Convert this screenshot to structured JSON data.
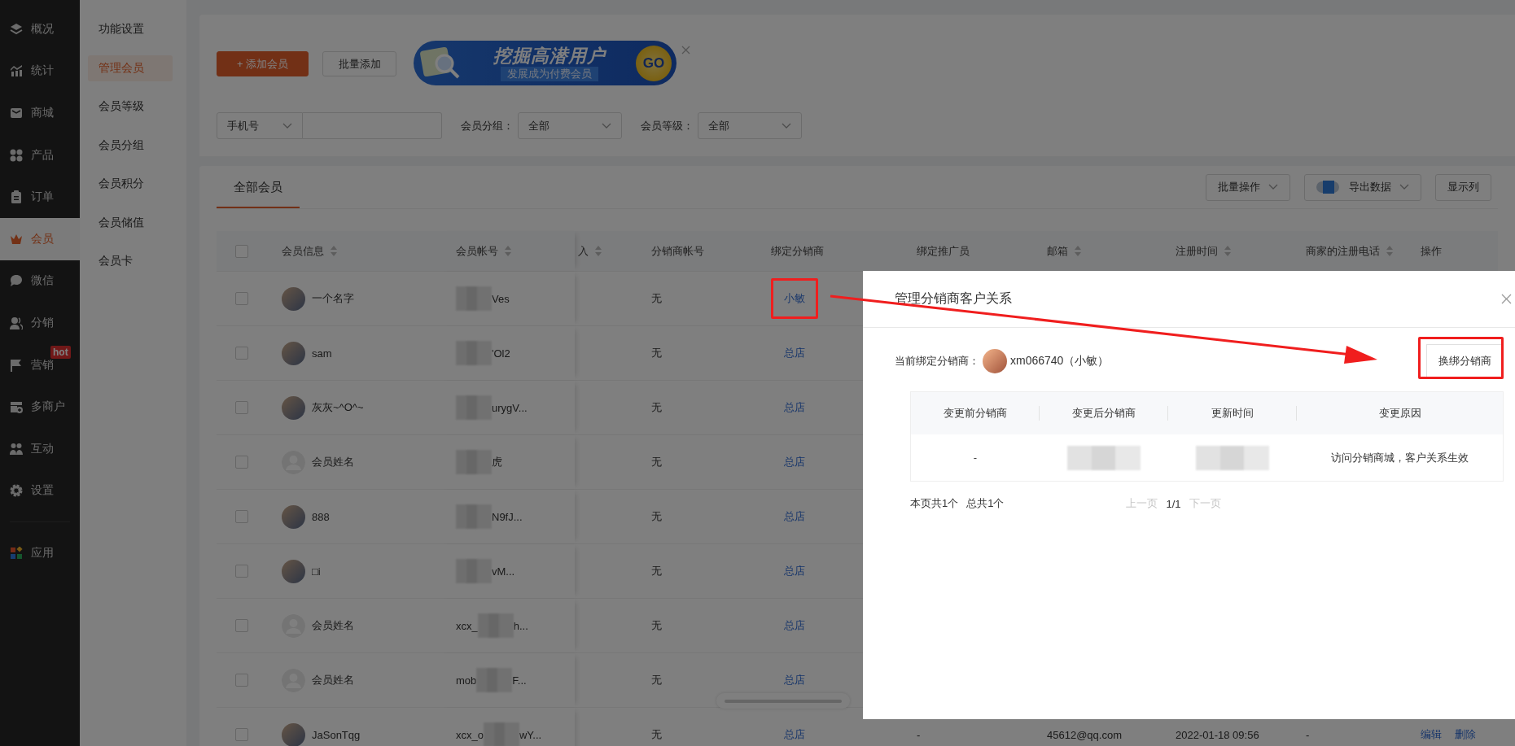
{
  "sidebar": {
    "items": [
      {
        "label": "概况",
        "selected": false
      },
      {
        "label": "统计",
        "selected": false
      },
      {
        "label": "商城",
        "selected": false
      },
      {
        "label": "产品",
        "selected": false
      },
      {
        "label": "订单",
        "selected": false
      },
      {
        "label": "会员",
        "selected": true
      },
      {
        "label": "微信",
        "selected": false
      },
      {
        "label": "分销",
        "selected": false
      },
      {
        "label": "营销",
        "selected": false,
        "badge": "hot"
      },
      {
        "label": "多商户",
        "selected": false
      },
      {
        "label": "互动",
        "selected": false
      },
      {
        "label": "设置",
        "selected": false
      }
    ],
    "apps": {
      "label": "应用"
    }
  },
  "submenu": {
    "items": [
      {
        "label": "功能设置",
        "selected": false
      },
      {
        "label": "管理会员",
        "selected": true
      },
      {
        "label": "会员等级",
        "selected": false
      },
      {
        "label": "会员分组",
        "selected": false
      },
      {
        "label": "会员积分",
        "selected": false
      },
      {
        "label": "会员储值",
        "selected": false
      },
      {
        "label": "会员卡",
        "selected": false
      }
    ]
  },
  "toolbar": {
    "add_button": {
      "icon": "+",
      "label": "添加会员"
    },
    "batch_add_button": "批量添加",
    "banner": {
      "title": "挖掘高潜用户",
      "subtitle": "发展成为付费会员",
      "go": "GO"
    }
  },
  "filters": {
    "search_type": "手机号",
    "fields": [
      {
        "label": "会员分组：",
        "value": "全部"
      },
      {
        "label": "会员等级：",
        "value": "全部"
      }
    ]
  },
  "member_list": {
    "tabs": [
      {
        "label": "全部会员",
        "selected": true
      }
    ],
    "actions": [
      {
        "label": "批量操作",
        "kind": "dropdown"
      },
      {
        "label": "导出数据",
        "kind": "export"
      },
      {
        "label": "显示列",
        "kind": "plain"
      }
    ],
    "table": {
      "select_all_checked": false,
      "columns": [
        {
          "label": "会员信息",
          "sortable": true
        },
        {
          "label": "会员帐号",
          "sortable": true
        },
        {
          "label": "入",
          "sortable": true
        },
        {
          "label": "分销商帐号",
          "sortable": false
        },
        {
          "label": "绑定分销商",
          "sortable": false
        },
        {
          "label": "绑定推广员",
          "sortable": false
        },
        {
          "label": "邮箱",
          "sortable": true
        },
        {
          "label": "注册时间",
          "sortable": true
        },
        {
          "label": "商家的注册电话",
          "sortable": true
        },
        {
          "label": "操作",
          "sortable": false
        }
      ],
      "rows": [
        {
          "checked": false,
          "has_photo": true,
          "name": "一个名字",
          "account": {
            "suffix": "Ves"
          },
          "distributor_account": "无",
          "bound_distributor": "小敏",
          "highlighted": true
        },
        {
          "checked": false,
          "has_photo": true,
          "name": "sam",
          "account": {
            "suffix": "'Ol2"
          },
          "distributor_account": "无",
          "bound_distributor": "总店",
          "highlighted": false
        },
        {
          "checked": false,
          "has_photo": true,
          "name": "灰灰~^O^~",
          "account": {
            "suffix": "urygV..."
          },
          "distributor_account": "无",
          "bound_distributor": "总店",
          "highlighted": false
        },
        {
          "checked": false,
          "has_photo": false,
          "name": "会员姓名",
          "account": {
            "suffix": "虎"
          },
          "distributor_account": "无",
          "bound_distributor": "总店",
          "highlighted": false
        },
        {
          "checked": false,
          "has_photo": true,
          "name": "888",
          "account": {
            "suffix": "N9fJ..."
          },
          "distributor_account": "无",
          "bound_distributor": "总店",
          "highlighted": false
        },
        {
          "checked": false,
          "has_photo": true,
          "name": "□i",
          "account": {
            "suffix": "vM..."
          },
          "distributor_account": "无",
          "bound_distributor": "总店",
          "highlighted": false
        },
        {
          "checked": false,
          "has_photo": false,
          "name": "会员姓名",
          "account": {
            "prefix": "xcx_",
            "suffix": "h..."
          },
          "distributor_account": "无",
          "bound_distributor": "总店",
          "highlighted": false
        },
        {
          "checked": false,
          "has_photo": false,
          "name": "会员姓名",
          "account": {
            "prefix": "mob",
            "suffix": "F..."
          },
          "distributor_account": "无",
          "bound_distributor": "总店",
          "highlighted": false
        },
        {
          "checked": false,
          "has_photo": true,
          "name": "JaSonTqg",
          "account": {
            "prefix": "xcx_o",
            "suffix": "wY..."
          },
          "distributor_account": "无",
          "bound_distributor": "总店",
          "highlighted": false,
          "promoter": "-",
          "email": "45612@qq.com",
          "registered": "2022-01-18 09:56",
          "phone": "-",
          "actions": [
            "编辑",
            "删除"
          ]
        }
      ]
    }
  },
  "modal": {
    "title": "管理分销商客户关系",
    "current_label": "当前绑定分销商：",
    "current_value": "xm066740（小敏）",
    "change_button": {
      "label": "换绑分销商",
      "highlighted": true
    },
    "table": {
      "columns": [
        "变更前分销商",
        "变更后分销商",
        "更新时间",
        "变更原因"
      ],
      "rows": [
        [
          {
            "kind": "text",
            "text": "-"
          },
          {
            "kind": "blurred"
          },
          {
            "kind": "blurred"
          },
          {
            "kind": "text",
            "text": "访问分销商城，客户关系生效"
          }
        ]
      ]
    },
    "pagination": {
      "page_count": "本页共1个",
      "total": "总共1个",
      "prev": {
        "label": "上一页",
        "disabled": true
      },
      "page": "1/1",
      "next": {
        "label": "下一页",
        "disabled": true
      }
    }
  },
  "annotations": [
    {
      "kind": "arrow"
    }
  ]
}
